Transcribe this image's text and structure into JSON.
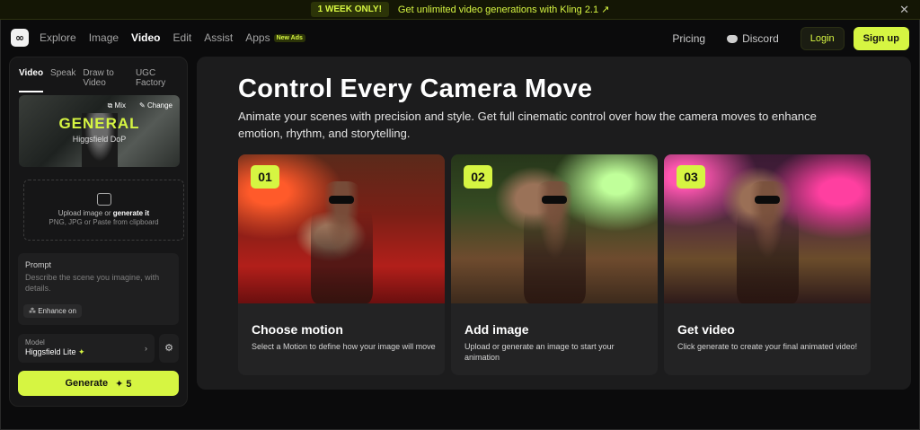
{
  "promo": {
    "tag": "1 WEEK ONLY!",
    "message": "Get unlimited video generations with Kling 2.1 ↗",
    "close": "✕"
  },
  "nav": {
    "logo": "∞",
    "items": [
      {
        "label": "Explore",
        "active": false
      },
      {
        "label": "Image",
        "active": false
      },
      {
        "label": "Video",
        "active": true
      },
      {
        "label": "Edit",
        "active": false
      },
      {
        "label": "Assist",
        "active": false
      },
      {
        "label": "Apps",
        "active": false
      }
    ],
    "apps_badge": "New Ads",
    "pricing": "Pricing",
    "discord": "Discord",
    "login": "Login",
    "signup": "Sign up"
  },
  "sidebar": {
    "tabs": [
      "Video",
      "Speak",
      "Draw to Video",
      "UGC Factory"
    ],
    "preset": {
      "title": "GENERAL",
      "subtitle": "Higgsfield DoP",
      "mix": "⧉ Mix",
      "change": "✎ Change"
    },
    "upload": {
      "line1_prefix": "Upload image or",
      "line1_link": "generate it",
      "line2": "PNG, JPG or Paste from clipboard"
    },
    "prompt": {
      "label": "Prompt",
      "placeholder": "Describe the scene you imagine, with details.",
      "enhance": "⁂ Enhance on"
    },
    "model": {
      "label": "Model",
      "value": "Higgsfield Lite",
      "spark": "✦",
      "chevron": "›"
    },
    "settings_icon": "⚙",
    "generate": {
      "label": "Generate",
      "cost": "✦ 5"
    }
  },
  "main": {
    "headline": "Control Every Camera Move",
    "description": "Animate your scenes with precision and style. Get full cinematic control over how the camera moves to enhance emotion, rhythm, and storytelling.",
    "steps": [
      {
        "num": "01",
        "title": "Choose motion",
        "desc": "Select a Motion to define how your image will move"
      },
      {
        "num": "02",
        "title": "Add image",
        "desc": "Upload or generate an image to start your animation"
      },
      {
        "num": "03",
        "title": "Get video",
        "desc": "Click generate to create your final animated video!"
      }
    ]
  },
  "colors": {
    "accent": "#d6f542",
    "background": "#0b0b0c",
    "panel": "#1c1c1d"
  }
}
